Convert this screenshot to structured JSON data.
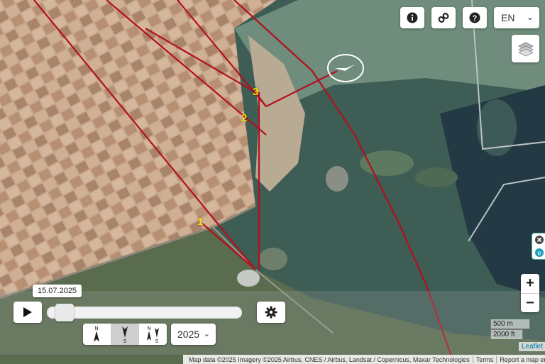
{
  "map": {
    "track_color": "#b3101e",
    "point_label_color": "#f5e000",
    "points": [
      {
        "label": "1"
      },
      {
        "label": "2"
      },
      {
        "label": "3"
      }
    ]
  },
  "toolbar": {
    "info_icon": "info-icon",
    "link_icon": "link-icon",
    "help_icon": "help-icon",
    "language": "EN",
    "layers_icon": "layers-icon"
  },
  "timeline": {
    "date": "15.07.2025",
    "play_icon": "play-icon",
    "settings_icon": "gear-icon",
    "year": "2025",
    "slider_position": 0.05,
    "directions": [
      {
        "top": "N",
        "bottom": "",
        "icon": "north-arrow-icon"
      },
      {
        "top": "",
        "bottom": "S",
        "icon": "south-arrow-icon"
      },
      {
        "top": "N",
        "bottom": "S",
        "icon": "north-south-arrow-icon"
      }
    ]
  },
  "zoom": {
    "in": "+",
    "out": "−"
  },
  "scale": {
    "metric": "500 m",
    "imperial": "2000 ft"
  },
  "attribution": {
    "leaflet": "Leaflet",
    "text": "Map data ©2025 Imagery ©2025 Airbus, CNES / Airbus, Landsat / Copernicus, Maxar Technologies",
    "terms": "Terms",
    "report": "Report a map error"
  }
}
